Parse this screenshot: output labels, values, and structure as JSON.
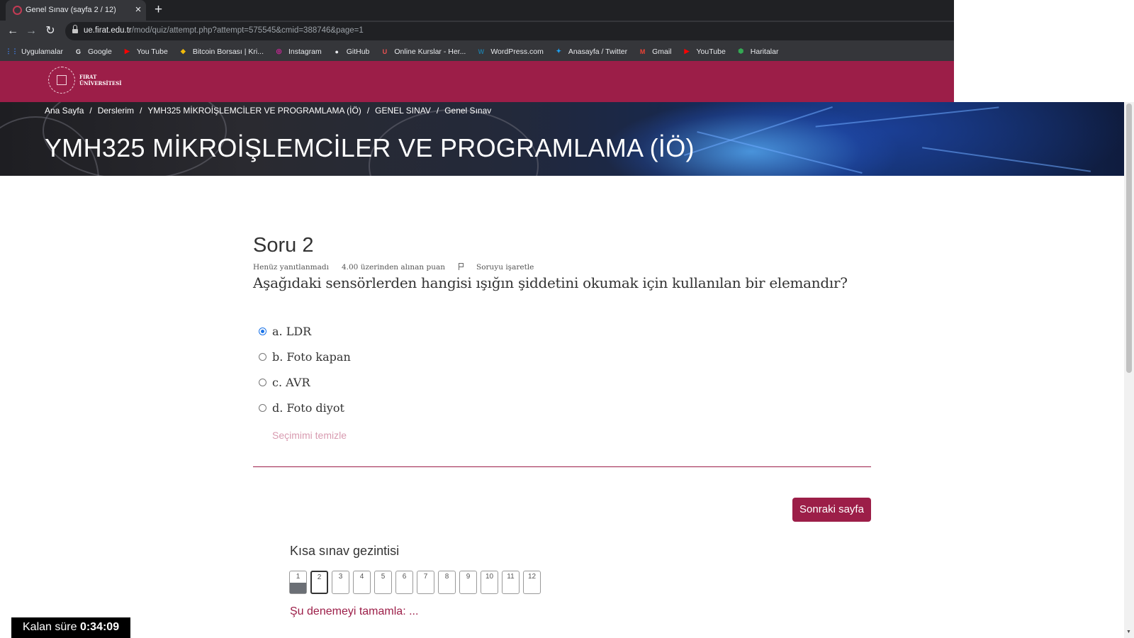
{
  "browser": {
    "tab_title": "Genel Sınav (sayfa 2 / 12)",
    "tab_close": "×",
    "new_tab": "+",
    "url_host": "ue.firat.edu.tr",
    "url_path": "/mod/quiz/attempt.php?attempt=575545&cmid=388746&page=1",
    "back": "←",
    "forward": "→",
    "reload": "↻",
    "bookmarks": [
      {
        "label": "Uygulamalar",
        "icon": "apps-grid-icon",
        "color": "#4285f4"
      },
      {
        "label": "Google",
        "icon": "google-icon",
        "color": "#ffffff"
      },
      {
        "label": "You Tube",
        "icon": "youtube-icon",
        "color": "#ff0000"
      },
      {
        "label": "Bitcoin Borsası | Kri...",
        "icon": "binance-icon",
        "color": "#f0b90b"
      },
      {
        "label": "Instagram",
        "icon": "instagram-icon",
        "color": "#d6249f"
      },
      {
        "label": "GitHub",
        "icon": "github-icon",
        "color": "#ffffff"
      },
      {
        "label": "Online Kurslar - Her...",
        "icon": "udemy-icon",
        "color": "#ec5252"
      },
      {
        "label": "WordPress.com",
        "icon": "wordpress-icon",
        "color": "#21759b"
      },
      {
        "label": "Anasayfa / Twitter",
        "icon": "twitter-icon",
        "color": "#1da1f2"
      },
      {
        "label": "Gmail",
        "icon": "gmail-icon",
        "color": "#ea4335"
      },
      {
        "label": "YouTube",
        "icon": "youtube-icon",
        "color": "#ff0000"
      },
      {
        "label": "Haritalar",
        "icon": "maps-icon",
        "color": "#34a853"
      }
    ]
  },
  "site": {
    "logo_line1": "FIRAT",
    "logo_line2": "ÜNİVERSİTESİ",
    "brand_color": "#9c1e48"
  },
  "breadcrumb": [
    "Ana Sayfa",
    "Derslerim",
    "YMH325 MİKROİŞLEMCİLER VE PROGRAMLAMA (İÖ)",
    "GENEL SINAV",
    "Genel Sınav"
  ],
  "breadcrumb_sep": "/",
  "course_title": "YMH325 MİKROİŞLEMCİLER VE PROGRAMLAMA (İÖ)",
  "question": {
    "number": "Soru 2",
    "status": "Henüz yanıtlanmadı",
    "points": "4.00 üzerinden alınan puan",
    "flag": "Soruyu işaretle",
    "text": "Aşağıdaki sensörlerden hangisi ışığın şiddetini okumak için kullanılan bir elemandır?",
    "answers": [
      {
        "label": "a. LDR",
        "checked": true
      },
      {
        "label": "b. Foto kapan",
        "checked": false
      },
      {
        "label": "c. AVR",
        "checked": false
      },
      {
        "label": "d. Foto diyot",
        "checked": false
      }
    ],
    "clear_choice": "Seçimimi temizle"
  },
  "next_page": "Sonraki sayfa",
  "quiz_nav": {
    "title": "Kısa sınav gezintisi",
    "buttons": [
      "1",
      "2",
      "3",
      "4",
      "5",
      "6",
      "7",
      "8",
      "9",
      "10",
      "11",
      "12"
    ],
    "answered": [
      "1"
    ],
    "current": "2",
    "finish": "Şu denemeyi tamamla: ..."
  },
  "timer": {
    "label": "Kalan süre",
    "value": "0:34:09"
  }
}
